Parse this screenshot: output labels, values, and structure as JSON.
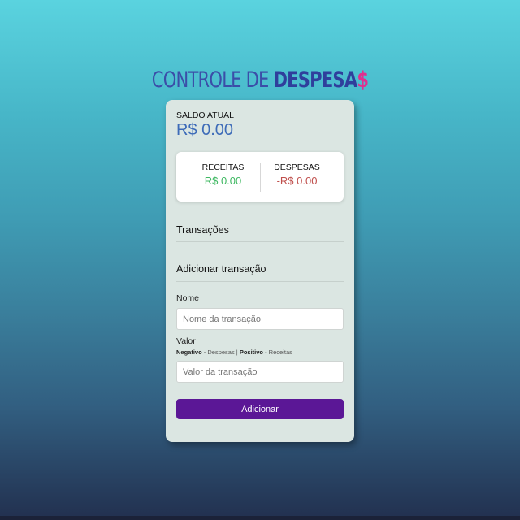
{
  "header": {
    "title_part1": "CONTROLE DE ",
    "title_part2": "DESPESA",
    "title_part3": "$"
  },
  "balance": {
    "label": "SALDO ATUAL",
    "value": "R$ 0.00"
  },
  "summary": {
    "income_label": "RECEITAS",
    "income_value": "R$ 0.00",
    "expense_label": "DESPESAS",
    "expense_value": "-R$ 0.00"
  },
  "transactions": {
    "title": "Transações"
  },
  "form": {
    "title": "Adicionar transação",
    "name_label": "Nome",
    "name_placeholder": "Nome da transação",
    "name_value": "",
    "value_label": "Valor",
    "hint_negative": "Negativo",
    "hint_negative_text": " - Despesas | ",
    "hint_positive": "Positivo",
    "hint_positive_text": " - Receitas",
    "value_placeholder": "Valor da transação",
    "value_value": "",
    "submit_label": "Adicionar"
  },
  "colors": {
    "title_light": "#3b4ea8",
    "title_dark": "#2f3f9c",
    "title_accent": "#e0308f",
    "balance": "#3d6bb8",
    "income": "#3fb862",
    "expense": "#c0504d",
    "button": "#5b1796",
    "card": "#dbe6e2"
  }
}
